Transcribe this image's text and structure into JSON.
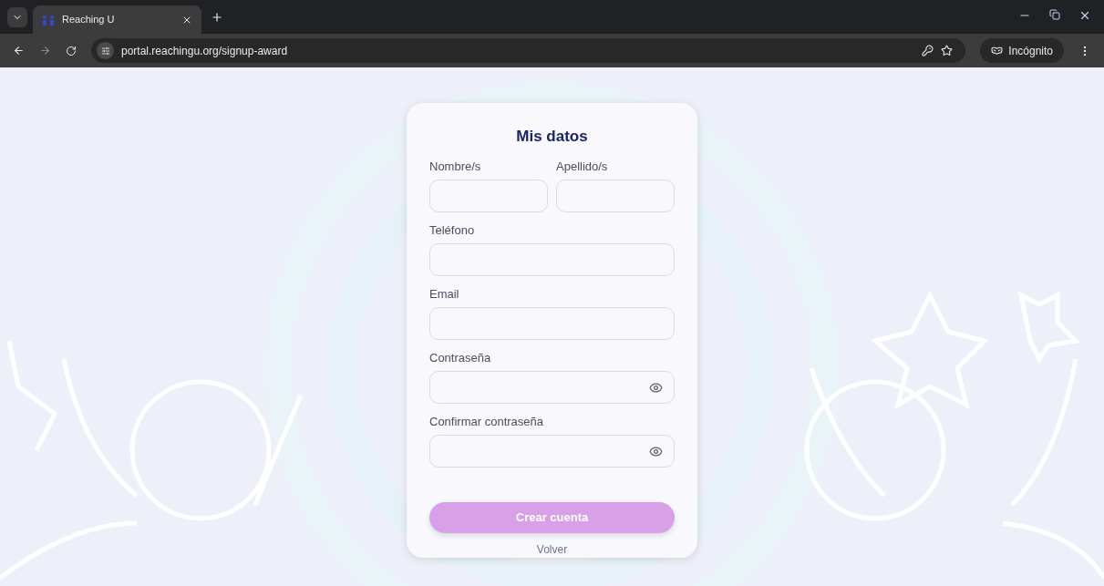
{
  "browser": {
    "tab_title": "Reaching U",
    "url": "portal.reachingu.org/signup-award",
    "profile": "Incógnito"
  },
  "form": {
    "title": "Mis datos",
    "rows": [
      [
        {
          "label": "Nombre/s",
          "kind": "text"
        },
        {
          "label": "Apellido/s",
          "kind": "text"
        }
      ],
      [
        {
          "label": "Teléfono",
          "kind": "text"
        }
      ],
      [
        {
          "label": "Email",
          "kind": "text"
        }
      ],
      [
        {
          "label": "Contraseña",
          "kind": "password"
        }
      ],
      [
        {
          "label": "Confirmar contraseña",
          "kind": "password"
        }
      ]
    ],
    "submit": {
      "label": "Crear cuenta",
      "disabled": true
    },
    "back_link": "Volver"
  }
}
